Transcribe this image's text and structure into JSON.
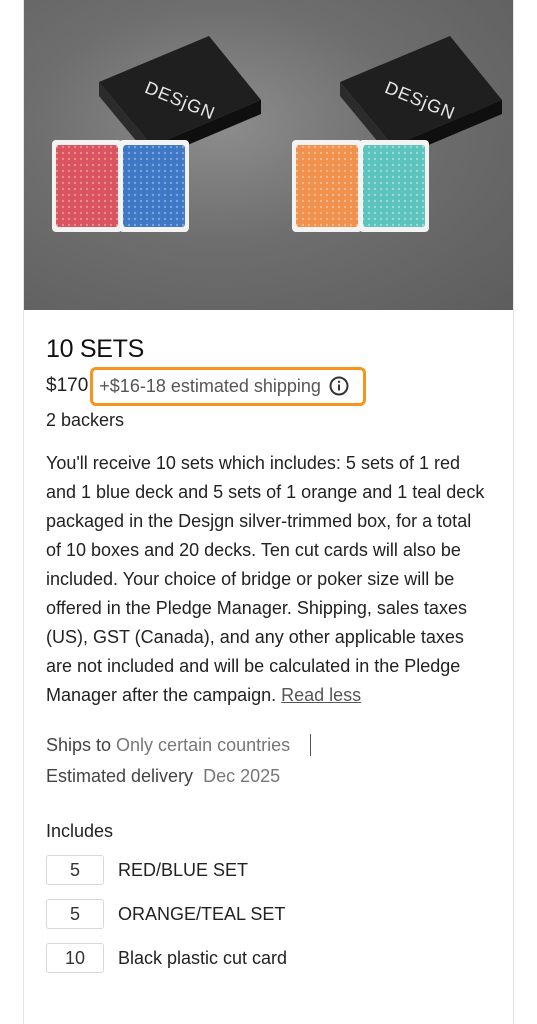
{
  "reward": {
    "hero": {
      "brand_left": "DESjGN",
      "brand_right": "DESjGN"
    },
    "title": "10 SETS",
    "price": "$170",
    "shipping": "+$16-18 estimated shipping",
    "backers": "2 backers",
    "description": "You'll receive 10 sets which includes: 5 sets of 1 red and 1 blue deck and 5 sets of 1 orange and 1 teal deck packaged in the Desjgn silver-trimmed box, for a total of 10 boxes and 20 decks. Ten cut cards will also be included. Your choice of bridge or poker size will be offered in the Pledge Manager. Shipping, sales taxes (US), GST (Canada), and any other applicable taxes are not included and will be calculated in the Pledge Manager after the campaign.",
    "read_less": "Read less",
    "ships_to_label": "Ships to",
    "ships_to_value": "Only certain countries",
    "delivery_label": "Estimated delivery",
    "delivery_value": "Dec 2025",
    "includes_heading": "Includes",
    "includes": [
      {
        "qty": "5",
        "label": "RED/BLUE SET"
      },
      {
        "qty": "5",
        "label": "ORANGE/TEAL SET"
      },
      {
        "qty": "10",
        "label": "Black plastic cut card"
      }
    ]
  },
  "colors": {
    "highlight": "#f7931e",
    "deck_red": "#d9545f",
    "deck_blue": "#3f78c4",
    "deck_orange": "#f0914e",
    "deck_teal": "#5cc3bd"
  }
}
